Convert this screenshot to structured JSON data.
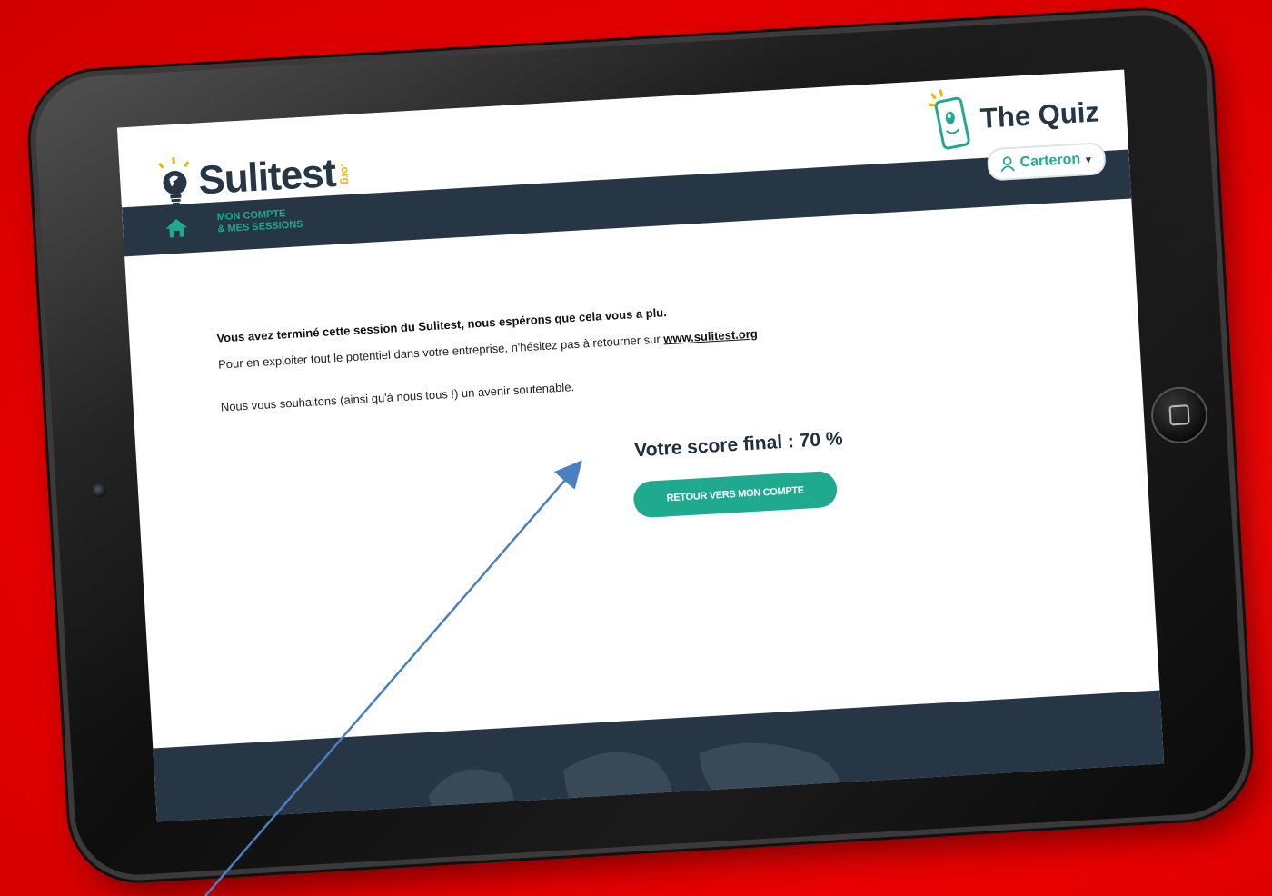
{
  "brand": {
    "logo_text": "Sulitest",
    "logo_suffix": ".org",
    "quiz_title": "The Quiz"
  },
  "user": {
    "name": "Carteron"
  },
  "nav": {
    "account_line1": "MON COMPTE",
    "account_line2": "& MES SESSIONS"
  },
  "content": {
    "line1": "Vous avez terminé cette session du Sulitest, nous espérons que cela vous a plu.",
    "line2_prefix": "Pour en exploiter tout le potentiel dans votre entreprise, n'hésitez pas à retourner sur ",
    "line2_link": "www.sulitest.org",
    "line3": "Nous vous souhaitons (ainsi qu'à nous tous !) un avenir soutenable.",
    "score": "Votre score final : 70 %",
    "return_button": "RETOUR VERS MON COMPTE"
  },
  "colors": {
    "accent": "#1fa98e",
    "navy": "#263645",
    "background": "#f00000",
    "arrow": "#4a7fc1"
  },
  "icons": {
    "home": "home-icon",
    "user": "user-icon",
    "chevron": "chevron-down-icon",
    "bulb": "lightbulb-globe-icon",
    "phone": "phone-mascot-icon"
  }
}
